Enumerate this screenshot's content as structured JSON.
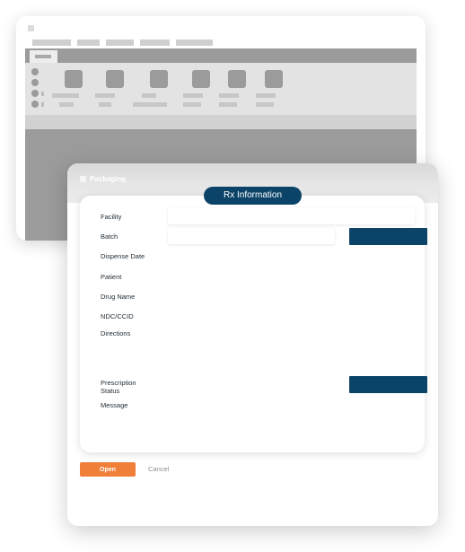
{
  "dialog": {
    "title": "Packaging",
    "section_title": "Rx Information",
    "fields": {
      "facility": "Facility",
      "batch": "Batch",
      "dispense_date": "Dispense Date",
      "patient": "Patient",
      "drug_name": "Drug Name",
      "ndc_ccid": "NDC/CCID",
      "directions": "Directions",
      "prescription_status_line1": "Prescription",
      "prescription_status_line2": "Status",
      "message": "Message"
    },
    "facility_value": "",
    "batch_value": "",
    "batch_button_label": "",
    "status_button_label": "",
    "open_label": "Open",
    "cancel_label": "Cancel"
  },
  "colors": {
    "accent_navy": "#0b4468",
    "accent_orange": "#f07f3a",
    "placeholder_gray": "#9b9b9b"
  }
}
